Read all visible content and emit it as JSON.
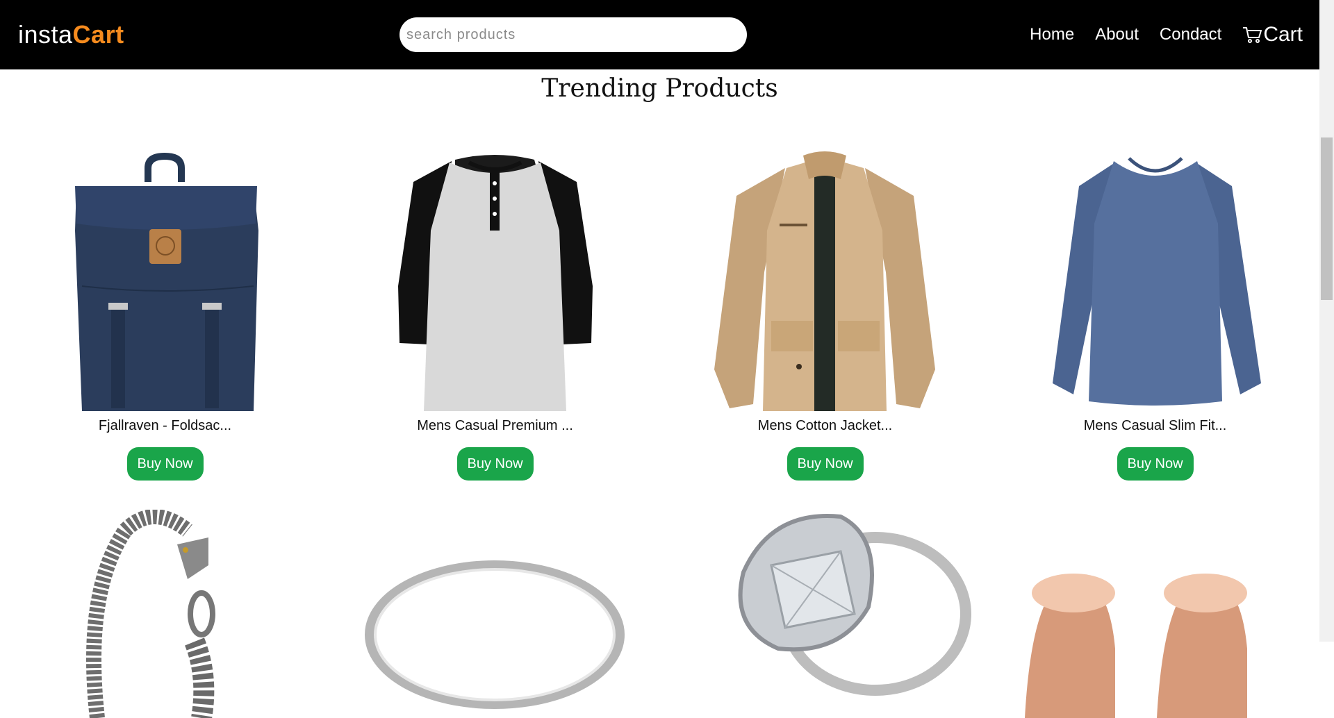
{
  "brand": {
    "part1": "insta",
    "part2": "Cart",
    "accent": "#f68b1e"
  },
  "search": {
    "placeholder": "search products",
    "value": ""
  },
  "nav": {
    "home": "Home",
    "about": "About",
    "contact": "Condact",
    "cart": "Cart"
  },
  "page_title": "Trending Products",
  "buy_color": "#1aa54a",
  "products": [
    {
      "name": "Fjallraven - Foldsac...",
      "buy": "Buy Now",
      "image": "backpack"
    },
    {
      "name": "Mens Casual Premium ...",
      "buy": "Buy Now",
      "image": "raglan-tshirt"
    },
    {
      "name": "Mens Cotton Jacket...",
      "buy": "Buy Now",
      "image": "cotton-jacket"
    },
    {
      "name": "Mens Casual Slim Fit...",
      "buy": "Buy Now",
      "image": "slim-fit-shirt"
    }
  ],
  "products_row2": [
    {
      "image": "dragon-bracelet"
    },
    {
      "image": "silver-ring"
    },
    {
      "image": "diamond-ring"
    },
    {
      "image": "rose-gold-plugs"
    }
  ]
}
